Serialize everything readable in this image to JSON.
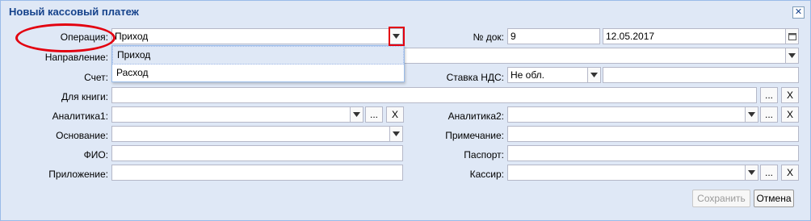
{
  "window": {
    "title": "Новый кассовый платеж"
  },
  "labels": {
    "operation": "Операция:",
    "direction": "Направление:",
    "account": "Счет:",
    "doc_no": "№ док:",
    "vat_rate": "Ставка НДС:",
    "for_book": "Для книги:",
    "analytics1": "Аналитика1:",
    "analytics2": "Аналитика2:",
    "basis": "Основание:",
    "note": "Примечание:",
    "fio": "ФИО:",
    "passport": "Паспорт:",
    "attachment": "Приложение:",
    "cashier": "Кассир:"
  },
  "fields": {
    "operation": "Приход",
    "doc_no": "9",
    "doc_date": "12.05.2017",
    "vat_rate": "Не обл."
  },
  "dropdown": {
    "options": [
      "Приход",
      "Расход"
    ],
    "selected_index": 0
  },
  "buttons": {
    "dots": "...",
    "clear": "X",
    "save": "Сохранить",
    "cancel": "Отмена"
  },
  "annotation_color": "#e3000f"
}
